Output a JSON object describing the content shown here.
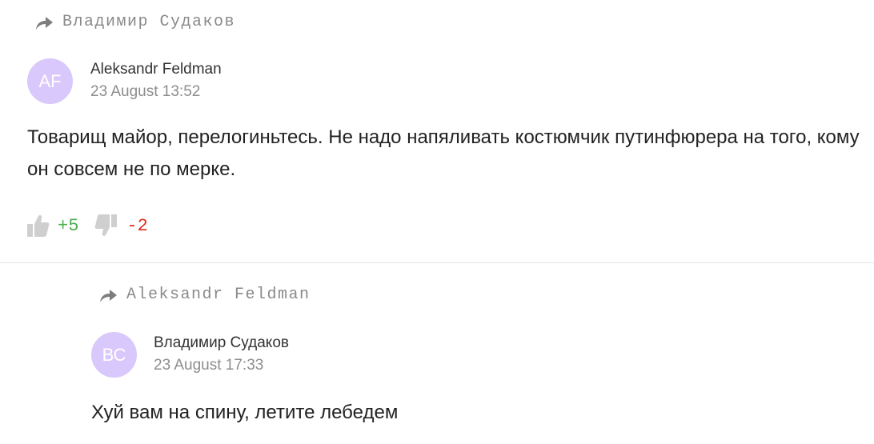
{
  "comments": [
    {
      "reply_to": "Владимир Судаков",
      "avatar_initials": "AF",
      "author": "Aleksandr Feldman",
      "date": "23 August 13:52",
      "text": "Товарищ майор, перелогиньтесь. Не надо напяливать костюмчик путинфюрера на того, кому он совсем не по мерке.",
      "upvotes": "+5",
      "downvotes": "-2"
    },
    {
      "reply_to": "Aleksandr Feldman",
      "avatar_initials": "ВС",
      "author": "Владимир Судаков",
      "date": "23 August 17:33",
      "text": "Хуй вам на спину, летите лебедем"
    }
  ],
  "colors": {
    "avatar_bg": "#d9c8fb",
    "upvote": "#4caf50",
    "downvote": "#e02a1e",
    "muted": "#8d8d8d"
  },
  "icons": [
    "reply-arrow-icon",
    "thumbs-up-icon",
    "thumbs-down-icon"
  ]
}
